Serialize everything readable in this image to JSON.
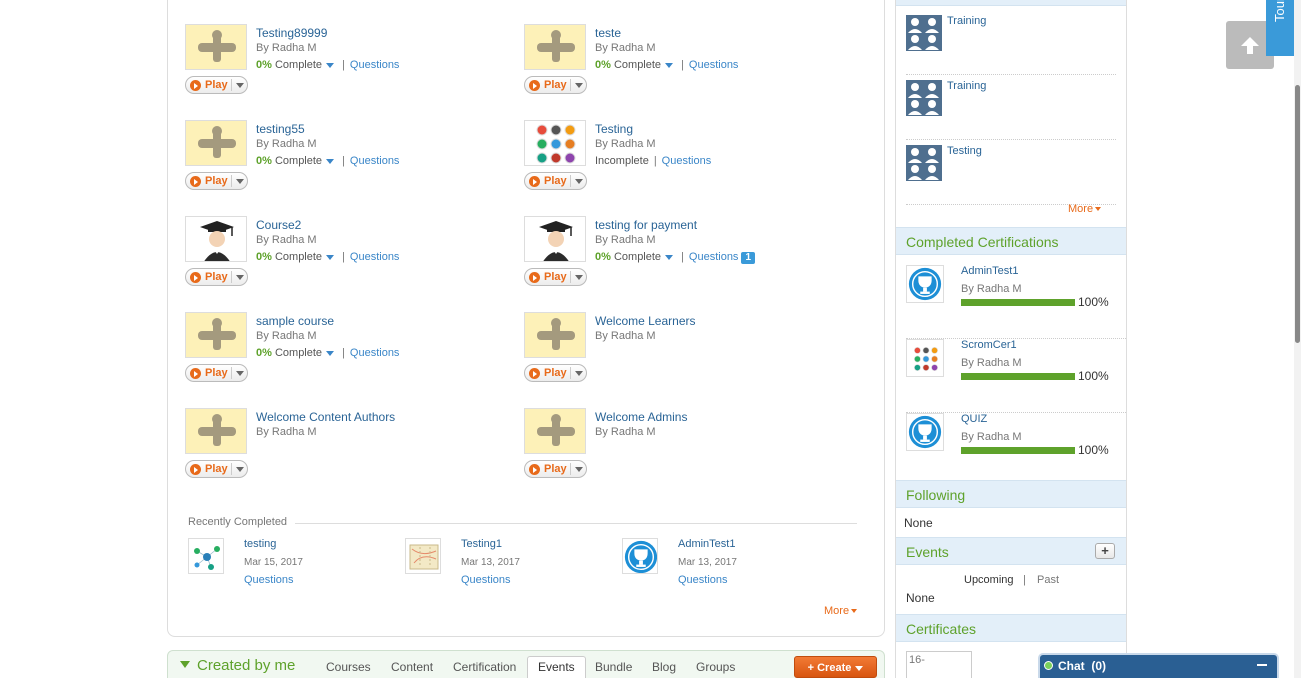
{
  "courses": [
    {
      "title": "Testing89999",
      "author": "By Radha M",
      "percent": "0%",
      "status": "Complete",
      "questions": "Questions",
      "thumb": "placeholder-icon"
    },
    {
      "title": "teste",
      "author": "By Radha M",
      "percent": "0%",
      "status": "Complete",
      "questions": "Questions",
      "thumb": "placeholder-icon"
    },
    {
      "title": "testing55",
      "author": "By Radha M",
      "percent": "0%",
      "status": "Complete",
      "questions": "Questions",
      "thumb": "placeholder-icon"
    },
    {
      "title": "Testing",
      "author": "By Radha M",
      "status_plain": "Incomplete",
      "questions": "Questions",
      "thumb": "badges-icon"
    },
    {
      "title": "Course2",
      "author": "By Radha M",
      "percent": "0%",
      "status": "Complete",
      "questions": "Questions",
      "thumb": "graduate-icon"
    },
    {
      "title": "testing for payment",
      "author": "By Radha M",
      "percent": "0%",
      "status": "Complete",
      "questions": "Questions",
      "badge": "1",
      "thumb": "graduate-icon"
    },
    {
      "title": "sample course",
      "author": "By Radha M",
      "percent": "0%",
      "status": "Complete",
      "questions": "Questions",
      "thumb": "placeholder-icon"
    },
    {
      "title": "Welcome Learners",
      "author": "By Radha M",
      "thumb": "placeholder-icon"
    },
    {
      "title": "Welcome Content Authors",
      "author": "By Radha M",
      "thumb": "placeholder-icon"
    },
    {
      "title": "Welcome Admins",
      "author": "By Radha M",
      "thumb": "placeholder-icon"
    }
  ],
  "play_label": "Play",
  "recently_completed": {
    "label": "Recently Completed",
    "items": [
      {
        "title": "testing",
        "date": "Mar 15, 2017",
        "questions": "Questions",
        "thumb": "network-icon"
      },
      {
        "title": "Testing1",
        "date": "Mar 13, 2017",
        "questions": "Questions",
        "thumb": "map-icon"
      },
      {
        "title": "AdminTest1",
        "date": "Mar 13, 2017",
        "questions": "Questions",
        "thumb": "trophy-icon"
      }
    ],
    "more": "More"
  },
  "created_by_me": {
    "title": "Created by me",
    "tabs": [
      "Courses",
      "Content",
      "Certification",
      "Events",
      "Bundle",
      "Blog",
      "Groups"
    ],
    "active_tab": "Events",
    "create_label": "+ Create"
  },
  "sidebar": {
    "groups": [
      {
        "name": "Training"
      },
      {
        "name": "Training"
      },
      {
        "name": "Testing"
      }
    ],
    "groups_more": "More",
    "completed_certifications": {
      "title": "Completed Certifications",
      "items": [
        {
          "name": "AdminTest1",
          "author": "By Radha M",
          "percent": "100%",
          "progress": 1.0,
          "icon": "trophy-icon"
        },
        {
          "name": "ScromCer1",
          "author": "By Radha M",
          "percent": "100%",
          "progress": 1.0,
          "icon": "badges-icon"
        },
        {
          "name": "QUIZ",
          "author": "By Radha M",
          "percent": "100%",
          "progress": 1.0,
          "icon": "trophy-icon"
        }
      ]
    },
    "following": {
      "title": "Following",
      "value": "None"
    },
    "events": {
      "title": "Events",
      "add": "+",
      "upcoming": "Upcoming",
      "separator": "|",
      "past": "Past",
      "value": "None"
    },
    "certificates": {
      "title": "Certificates",
      "image_alt": "16-"
    }
  },
  "tour_label": "Tour",
  "chat": {
    "label": "Chat",
    "count": "(0)"
  },
  "colors": {
    "accent_green": "#5ea22b",
    "link_blue": "#2a6496",
    "orange": "#e86a1a",
    "header_blue": "#e3eff9"
  }
}
